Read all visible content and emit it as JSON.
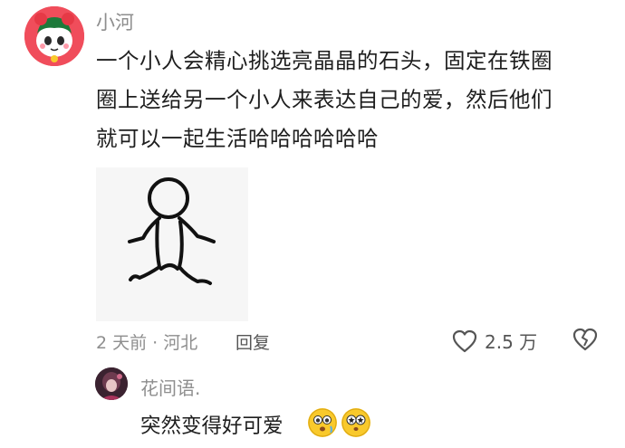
{
  "comment": {
    "username": "小河",
    "lines": [
      "一个小人会精心挑选亮晶晶的石头，固定在铁圈",
      "圈上送给另一个小人来表达自己的爱，然后他们",
      "就可以一起生活哈哈哈哈哈哈"
    ],
    "time_location": "2 天前 · 河北",
    "reply_label": "回复",
    "like_count": "2.5 万"
  },
  "reply": {
    "username": "花间语.",
    "text": "突然变得好可爱"
  },
  "colors": {
    "main_avatar_bg": "#f04d5b",
    "muted_text": "#8e8e8e",
    "emoji_yellow": "#f9c92b"
  },
  "icons": [
    "heart-outline-icon",
    "broken-heart-icon",
    "sparkle-eyes-emoji-icon",
    "star-eyes-emoji-icon"
  ]
}
